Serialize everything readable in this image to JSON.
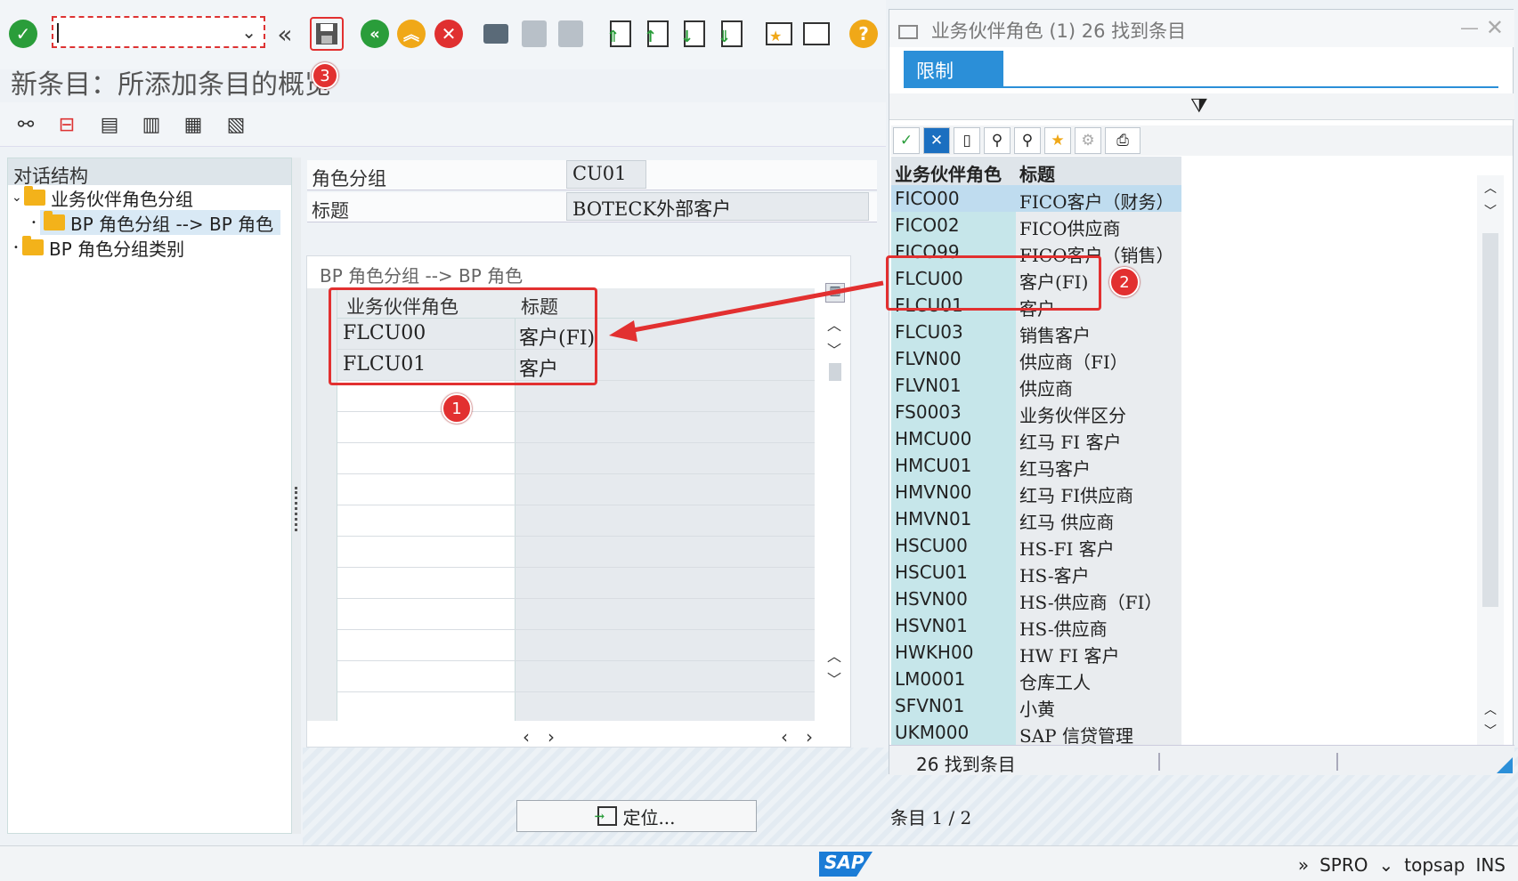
{
  "toolbar": {
    "command_field_value": "",
    "prev_label": "«",
    "help_label": "?"
  },
  "page_title": "新条目：所添加条目的概览",
  "tree": {
    "header": "对话结构",
    "items": [
      {
        "label": "业务伙伴角色分组",
        "level": 0,
        "expanded": true
      },
      {
        "label": "BP 角色分组 --> BP 角色",
        "level": 1,
        "selected": true
      },
      {
        "label": "BP 角色分组类别",
        "level": 0
      }
    ]
  },
  "form": {
    "role_group_label": "角色分组",
    "role_group_value": "CU01",
    "title_label": "标题",
    "title_value": "BOTECK外部客户"
  },
  "table": {
    "title": "BP 角色分组 --> BP 角色",
    "columns": [
      "业务伙伴角色",
      "标题"
    ],
    "rows": [
      {
        "role": "FLCU00",
        "title": "客户(FI)"
      },
      {
        "role": "FLCU01",
        "title": "客户"
      }
    ]
  },
  "locate_button": "定位...",
  "entry_count": "条目 1 / 2",
  "popup": {
    "title": "业务伙伴角色 (1)   26 找到条目",
    "tab_restrict": "限制",
    "columns": [
      "业务伙伴角色",
      "标题"
    ],
    "rows": [
      {
        "k": "FICO00",
        "v": "FICO客户（财务）"
      },
      {
        "k": "FICO02",
        "v": "FICO供应商"
      },
      {
        "k": "FICO99",
        "v": "FICO客户（销售）"
      },
      {
        "k": "FLCU00",
        "v": "客户(FI)"
      },
      {
        "k": "FLCU01",
        "v": "客户"
      },
      {
        "k": "FLCU03",
        "v": "销售客户"
      },
      {
        "k": "FLVN00",
        "v": "供应商（FI）"
      },
      {
        "k": "FLVN01",
        "v": "供应商"
      },
      {
        "k": "FS0003",
        "v": "业务伙伴区分"
      },
      {
        "k": "HMCU00",
        "v": "红马 FI 客户"
      },
      {
        "k": "HMCU01",
        "v": "红马客户"
      },
      {
        "k": "HMVN00",
        "v": "红马 FI供应商"
      },
      {
        "k": "HMVN01",
        "v": "红马 供应商"
      },
      {
        "k": "HSCU00",
        "v": "HS-FI 客户"
      },
      {
        "k": "HSCU01",
        "v": "HS-客户"
      },
      {
        "k": "HSVN00",
        "v": "HS-供应商（FI）"
      },
      {
        "k": "HSVN01",
        "v": "HS-供应商"
      },
      {
        "k": "HWKH00",
        "v": "HW FI 客户"
      },
      {
        "k": "LM0001",
        "v": "仓库工人"
      },
      {
        "k": "SFVN01",
        "v": "小黄"
      },
      {
        "k": "UKM000",
        "v": "SAP 信贷管理"
      }
    ],
    "status": "26 找到条目"
  },
  "callouts": [
    "1",
    "2",
    "3"
  ],
  "statusbar": {
    "sap_logo": "SAP",
    "expand": "»",
    "transaction": "SPRO",
    "dropdown": "⌄",
    "server": "topsap",
    "mode": "INS"
  },
  "colors": {
    "accent": "#2b8fd8",
    "highlight": "#e23030",
    "ok_green": "#2a9d3a",
    "cancel_red": "#e03030",
    "nav_yellow": "#f0a818"
  }
}
